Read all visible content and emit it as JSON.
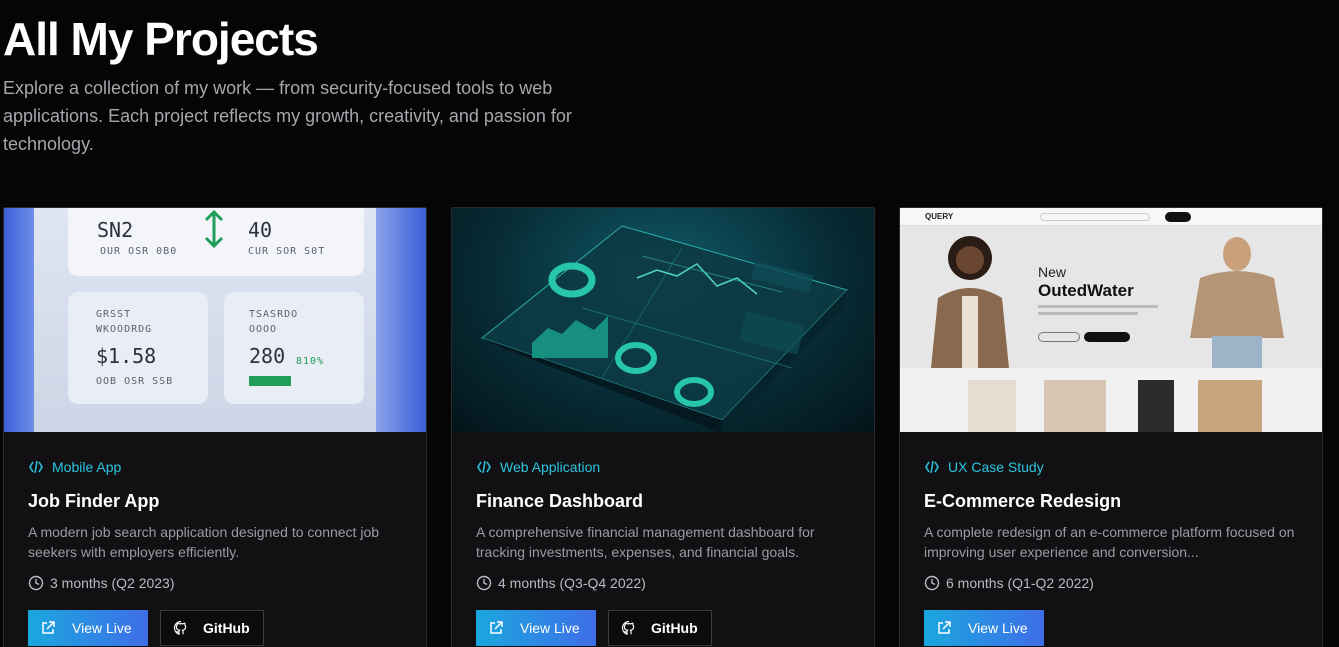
{
  "header": {
    "title": "All My Projects",
    "subtitle": "Explore a collection of my work — from security-focused tools to web applications. Each project reflects my growth, creativity, and passion for technology."
  },
  "colors": {
    "accent": "#2ec5e0",
    "button_gradient_start": "#1aa7de",
    "button_gradient_end": "#3f6ee8",
    "card_bg": "#111113"
  },
  "projects": [
    {
      "category": "Mobile App",
      "title": "Job Finder App",
      "description": "A modern job search application designed to connect job seekers with employers efficiently.",
      "duration": "3 months (Q2 2023)",
      "live_label": "View Live",
      "github_label": "GitHub",
      "thumb": {
        "top_left_value": "SN2",
        "top_left_sub": "OUR OSR 0B0",
        "top_right_value": "40",
        "top_right_sub": "CUR SOR S0T",
        "tile1_label_1": "GRSST",
        "tile1_label_2": "WKOODRDG",
        "tile1_value": "$1.58",
        "tile1_sub": "OOB OSR SSB",
        "tile2_label_1": "TSASRDO",
        "tile2_label_2": "OOOO",
        "tile2_value": "280",
        "tile2_pct": "810%"
      }
    },
    {
      "category": "Web Application",
      "title": "Finance Dashboard",
      "description": "A comprehensive financial management dashboard for tracking investments, expenses, and financial goals.",
      "duration": "4 months (Q3-Q4 2022)",
      "live_label": "View Live",
      "github_label": "GitHub"
    },
    {
      "category": "UX Case Study",
      "title": "E-Commerce Redesign",
      "description": "A complete redesign of an e-commerce platform focused on improving user experience and conversion...",
      "duration": "6 months (Q1-Q2 2022)",
      "live_label": "View Live",
      "thumb": {
        "brand": "QUERY",
        "headline_1": "New",
        "headline_2": "OutedWater"
      }
    }
  ]
}
